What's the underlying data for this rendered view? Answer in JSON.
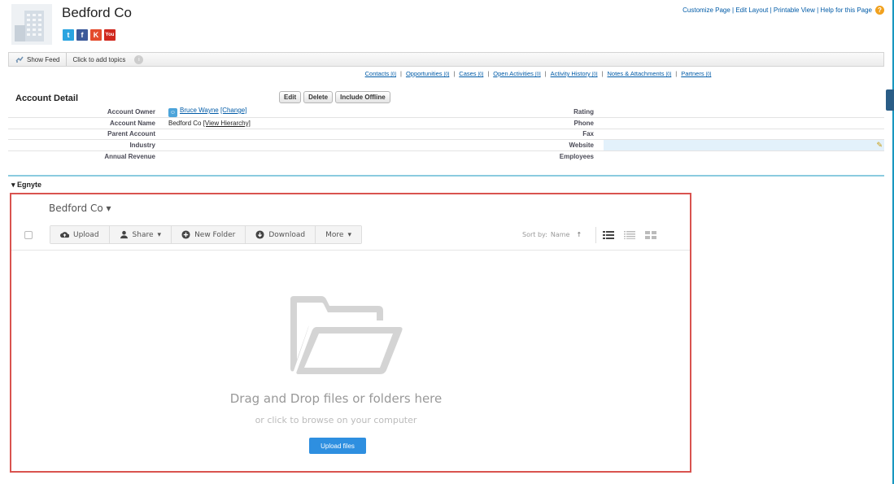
{
  "header": {
    "account_name": "Bedford Co",
    "social": {
      "twitter": "t",
      "facebook": "f",
      "klout": "K",
      "youtube": "You Tube"
    },
    "links": "Customize Page | Edit Layout | Printable View | Help for this Page",
    "help_icon": "?"
  },
  "feedbar": {
    "show_feed": "Show Feed",
    "topics": "Click to add topics",
    "info_icon": "i"
  },
  "related": [
    {
      "label": "Contacts",
      "count": "[0]"
    },
    {
      "label": "Opportunities",
      "count": "[0]"
    },
    {
      "label": "Cases",
      "count": "[0]"
    },
    {
      "label": "Open Activities",
      "count": "[0]"
    },
    {
      "label": "Activity History",
      "count": "[0]"
    },
    {
      "label": "Notes & Attachments",
      "count": "[0]"
    },
    {
      "label": "Partners",
      "count": "[0]"
    }
  ],
  "related_separator": "|",
  "detail": {
    "heading": "Account Detail",
    "buttons": {
      "edit": "Edit",
      "delete": "Delete",
      "offline": "Include Offline"
    },
    "rows": {
      "owner_label": "Account Owner",
      "owner_value": "Bruce Wayne",
      "owner_change": "[Change]",
      "name_label": "Account Name",
      "name_value": "Bedford Co",
      "name_hierarchy": "[View Hierarchy]",
      "parent_label": "Parent Account",
      "industry_label": "Industry",
      "revenue_label": "Annual Revenue",
      "rating_label": "Rating",
      "phone_label": "Phone",
      "fax_label": "Fax",
      "website_label": "Website",
      "employees_label": "Employees"
    },
    "section": "▾ Egnyte"
  },
  "egnyte": {
    "folder": "Bedford Co",
    "folder_caret": "▾",
    "toolbar": {
      "upload": "Upload",
      "share": "Share",
      "new_folder": "New Folder",
      "download": "Download",
      "more": "More"
    },
    "sort_label": "Sort by:",
    "sort_field": "Name",
    "sort_arrow": "↑",
    "drop_title": "Drag and Drop files or folders here",
    "drop_sub": "or click to browse on your computer",
    "upload_button": "Upload files"
  },
  "colors": {
    "link": "#015ba7",
    "accent_border": "#d9534f",
    "upload_button": "#2e8fe0",
    "divider": "#1797c0"
  }
}
